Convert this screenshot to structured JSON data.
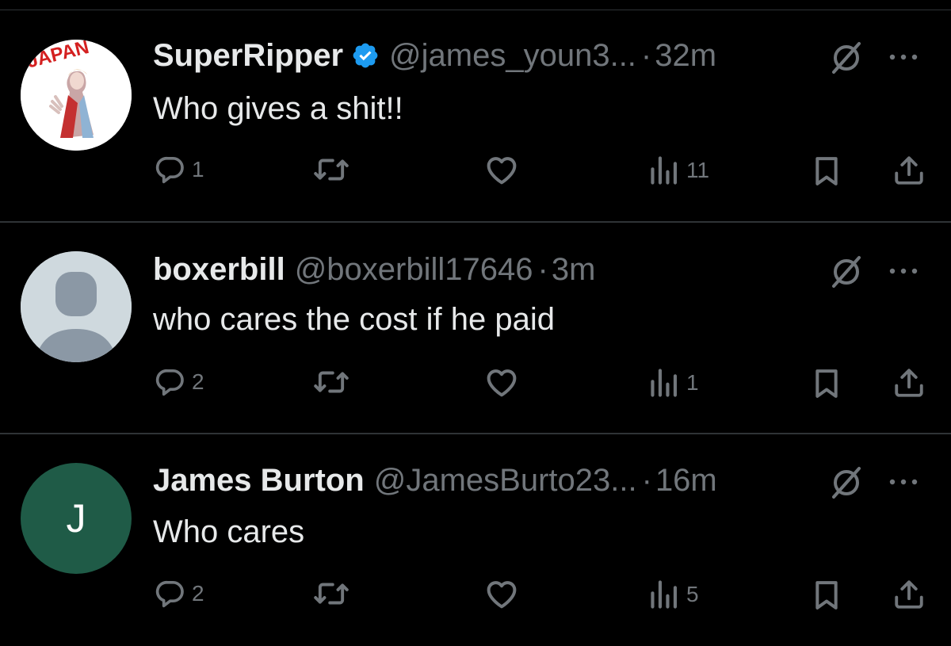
{
  "tweets": [
    {
      "display_name": "SuperRipper",
      "verified": true,
      "handle": "@james_youn3...",
      "separator": "·",
      "time": "32m",
      "text": "Who gives a shit!!",
      "avatar_type": "image",
      "avatar_logo_text": "JAPAN",
      "reply_count": "1",
      "retweet_count": "",
      "like_count": "",
      "view_count": "11"
    },
    {
      "display_name": "boxerbill",
      "verified": false,
      "handle": "@boxerbill17646",
      "separator": "·",
      "time": "3m",
      "text": "who cares the cost if he paid",
      "avatar_type": "default",
      "reply_count": "2",
      "retweet_count": "",
      "like_count": "",
      "view_count": "1"
    },
    {
      "display_name": "James Burton",
      "verified": false,
      "handle": "@JamesBurto23...",
      "separator": "·",
      "time": "16m",
      "text": "Who cares",
      "avatar_type": "initial",
      "avatar_initial": "J",
      "reply_count": "2",
      "retweet_count": "",
      "like_count": "",
      "view_count": "5"
    }
  ],
  "colors": {
    "background": "#000000",
    "primary_text": "#e7e9ea",
    "secondary_text": "#71767b",
    "divider": "#2f3336",
    "verified_badge": "#1d9bf0",
    "initial_avatar_bg": "#1f5b47",
    "default_avatar_bg": "#cfd9de",
    "default_avatar_figure": "#8b98a5"
  },
  "icons": {
    "reply": "speech-bubble-icon",
    "retweet": "retweet-arrows-icon",
    "like": "heart-icon",
    "views": "bar-chart-icon",
    "bookmark": "bookmark-icon",
    "share": "share-upload-icon",
    "grok": "grok-slash-circle-icon",
    "more": "more-dots-icon",
    "verified": "verified-badge-icon"
  }
}
